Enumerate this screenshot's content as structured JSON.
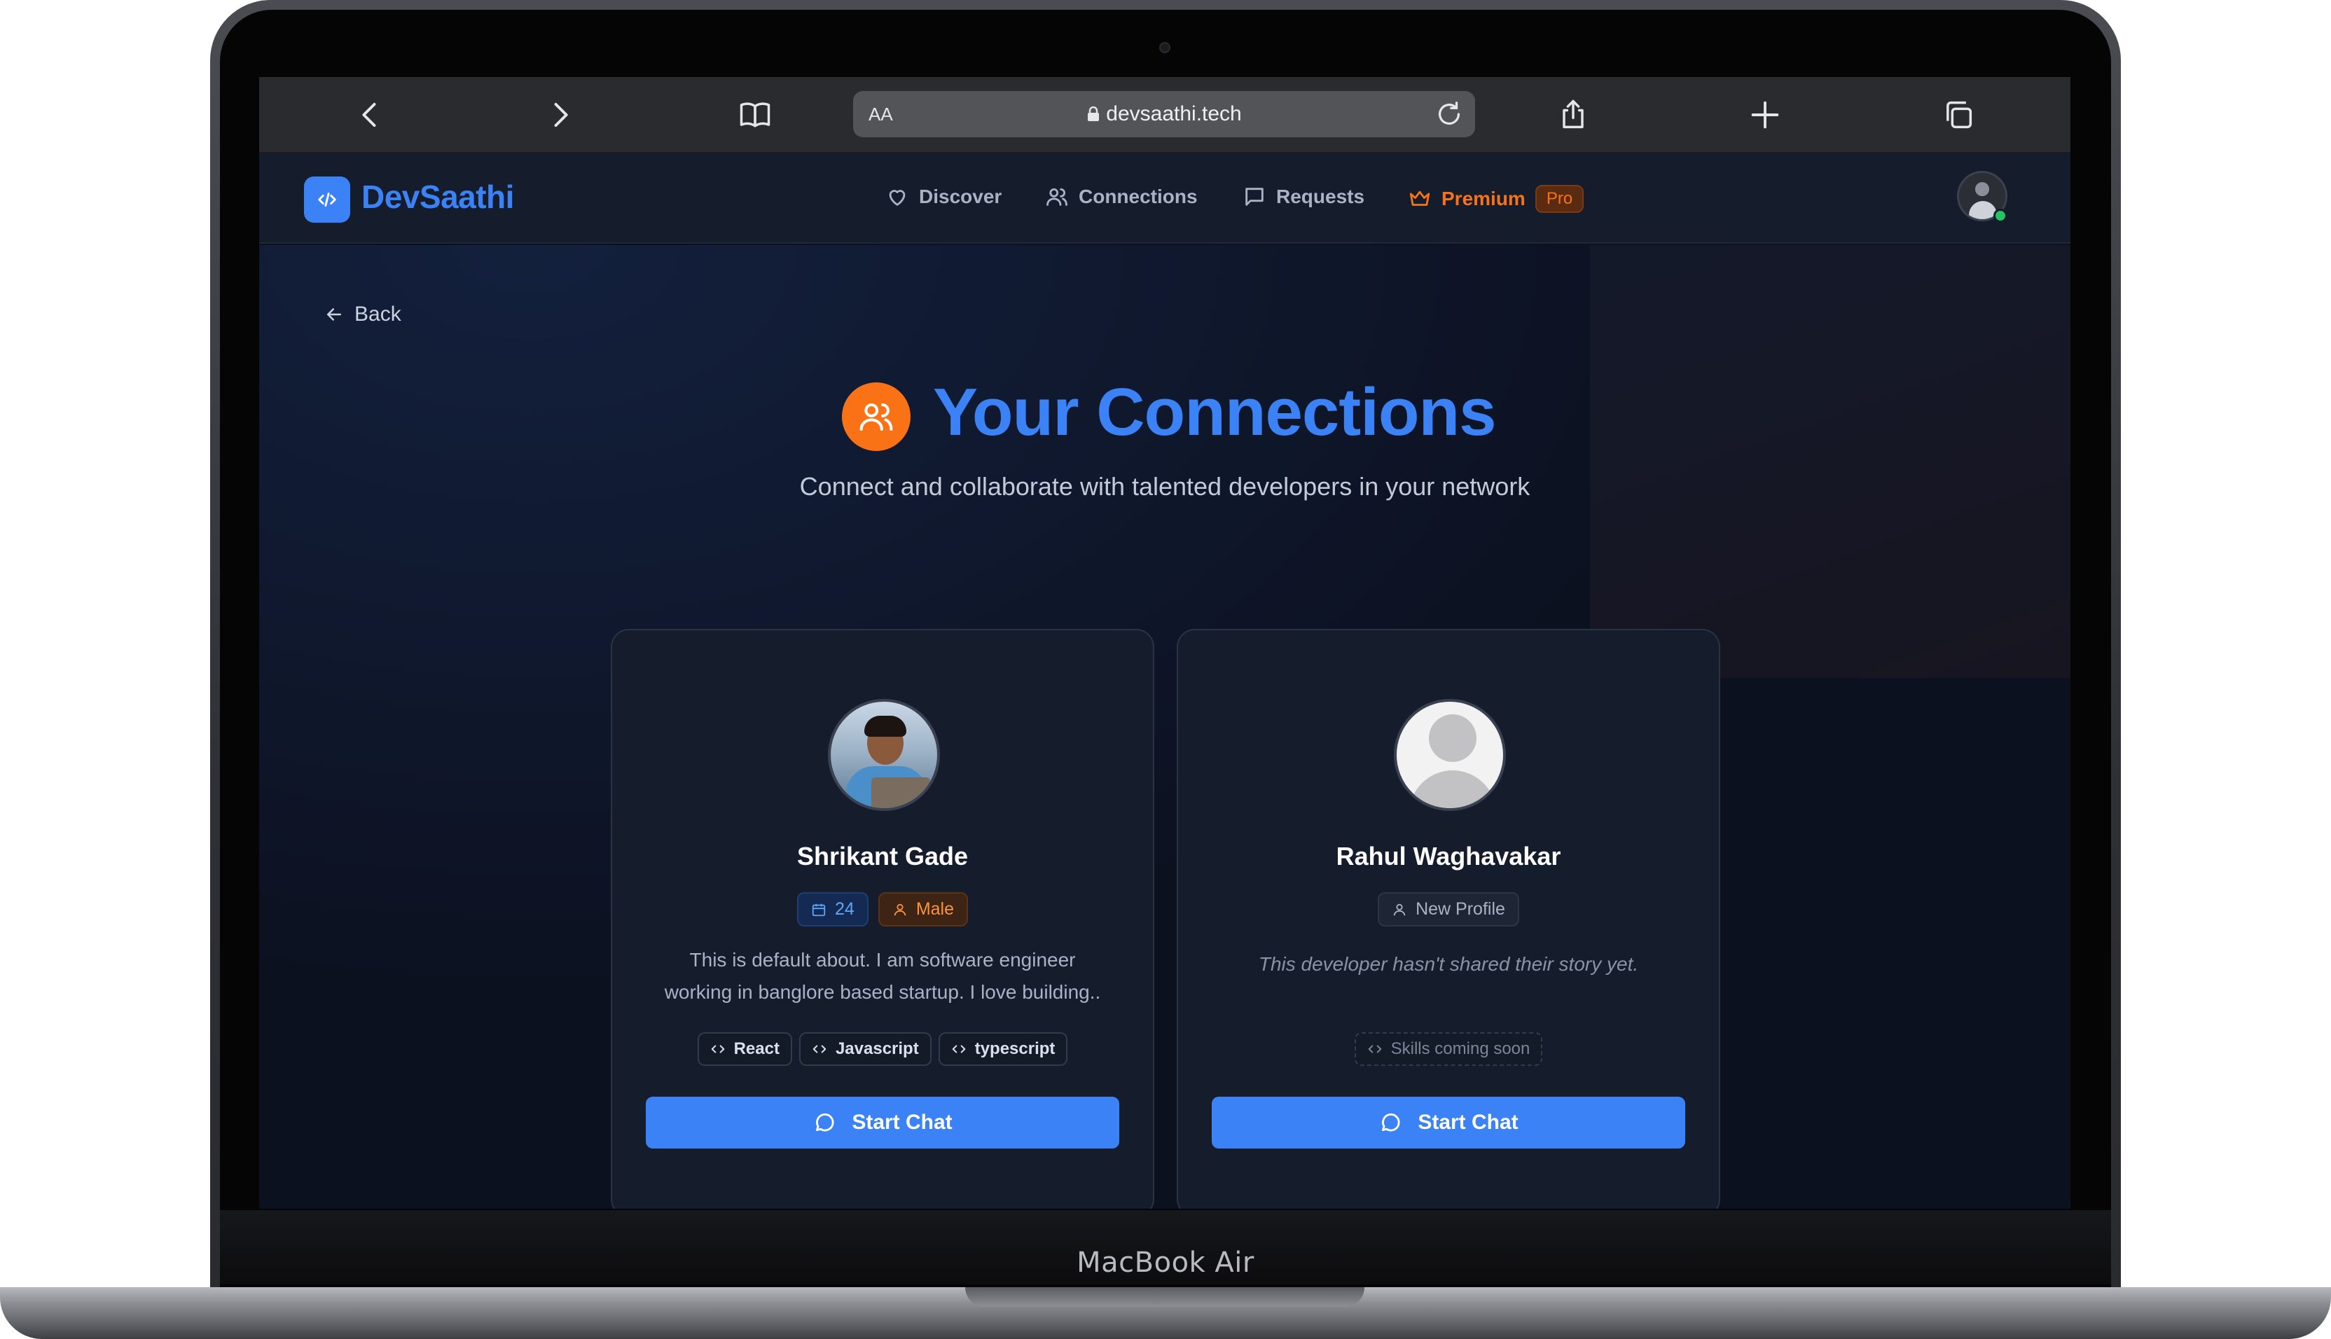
{
  "device": {
    "label": "MacBook Air"
  },
  "browser": {
    "aa_label": "AA",
    "url": "devsaathi.tech"
  },
  "app": {
    "brand": "DevSaathi",
    "nav": {
      "discover": "Discover",
      "connections": "Connections",
      "requests": "Requests",
      "premium": "Premium",
      "premium_badge": "Pro"
    },
    "accent": "#3b82f6",
    "premium_color": "#f97316"
  },
  "page": {
    "back": "Back",
    "title": "Your Connections",
    "subtitle": "Connect and collaborate with talented developers in your network"
  },
  "connections": [
    {
      "name": "Shrikant Gade",
      "age": "24",
      "gender": "Male",
      "about_line1": "This is default about. I am software engineer",
      "about_line2": "working in banglore based startup. I love building..",
      "skills": [
        "React",
        "Javascript",
        "typescript"
      ],
      "action": "Start Chat"
    },
    {
      "name": "Rahul Waghavakar",
      "status_badge": "New Profile",
      "about": "This developer hasn't shared their story yet.",
      "skills_placeholder": "Skills coming soon",
      "action": "Start Chat"
    }
  ]
}
